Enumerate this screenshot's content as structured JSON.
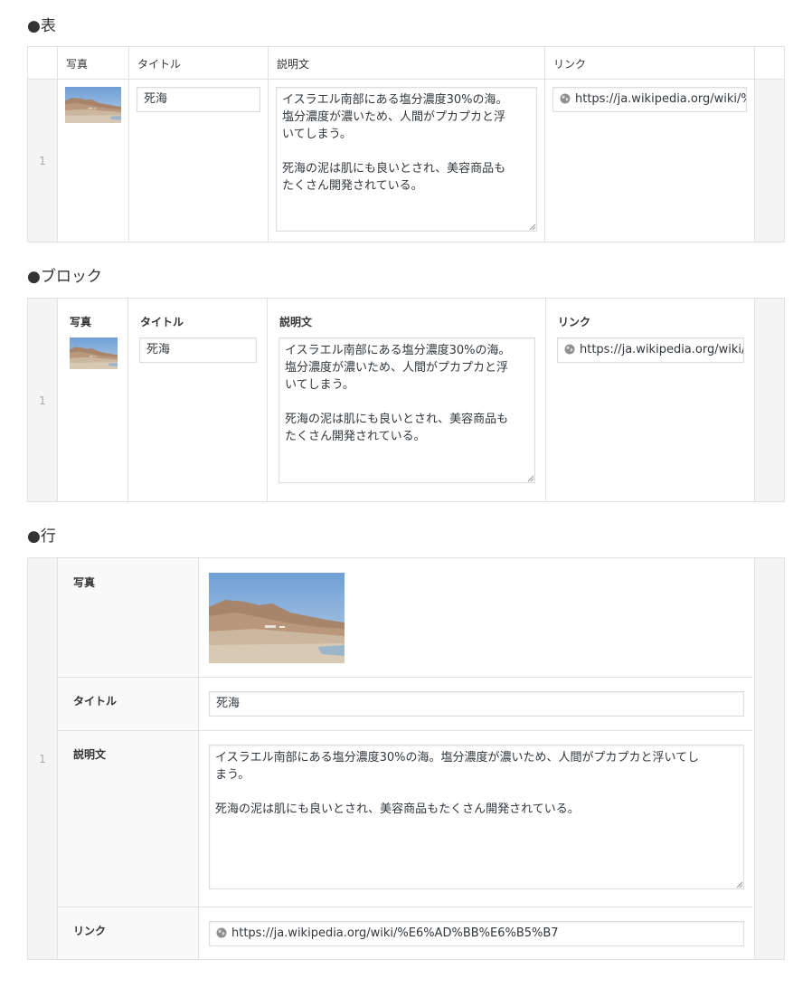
{
  "sections": {
    "table": {
      "heading": "●表"
    },
    "block": {
      "heading": "●ブロック"
    },
    "row": {
      "heading": "●行"
    }
  },
  "columns": {
    "photo": "写真",
    "title": "タイトル",
    "description": "説明文",
    "link": "リンク"
  },
  "entry": {
    "row_number": "1",
    "title": "死海",
    "description": "イスラエル南部にある塩分濃度30%の海。塩分濃度が濃いため、人間がプカプカと浮いてしまう。\n\n死海の泥は肌にも良いとされ、美容商品もたくさん開発されている。",
    "description_narrow": "イスラエル南部にある塩分濃度30%の海。\n塩分濃度が濃いため、人間がプカプカと浮\nいてしまう。\n\n死海の泥は肌にも良いとされ、美容商品も\nたくさん開発されている。",
    "description_wide": "イスラエル南部にある塩分濃度30%の海。塩分濃度が濃いため、人間がプカプカと浮いてし\nまう。\n\n死海の泥は肌にも良いとされ、美容商品もたくさん開発されている。",
    "link": "https://ja.wikipedia.org/wiki/%E6%AD%BB%E6%B5%B7"
  },
  "icons": {
    "link": "globe-icon",
    "resize": "resize-grip-icon"
  },
  "colors": {
    "border": "#e1e1e1",
    "handle": "#f4f4f4",
    "sky": "#7aa7d8",
    "sand": "#c9b49a"
  }
}
